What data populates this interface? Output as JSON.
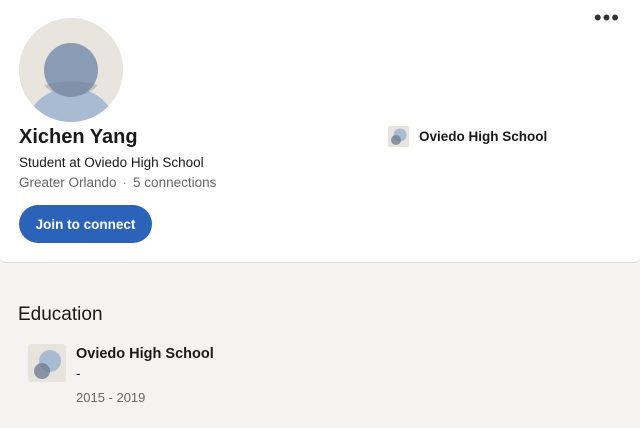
{
  "menu": {
    "more_icon": "ellipsis-icon",
    "more_label": "•••"
  },
  "profile": {
    "name": "Xichen Yang",
    "headline": "Student at Oviedo High School",
    "location": "Greater Orlando",
    "separator": "·",
    "connections": "5 connections",
    "join_label": "Join to connect",
    "current_school": "Oviedo High School"
  },
  "education": {
    "title": "Education",
    "items": [
      {
        "school": "Oviedo High School",
        "degree": "-",
        "dates": "2015 - 2019"
      }
    ]
  },
  "colors": {
    "accent": "#2b63b8",
    "avatar_bg": "#e8e5de",
    "avatar_figure": "#8a9bb5"
  }
}
